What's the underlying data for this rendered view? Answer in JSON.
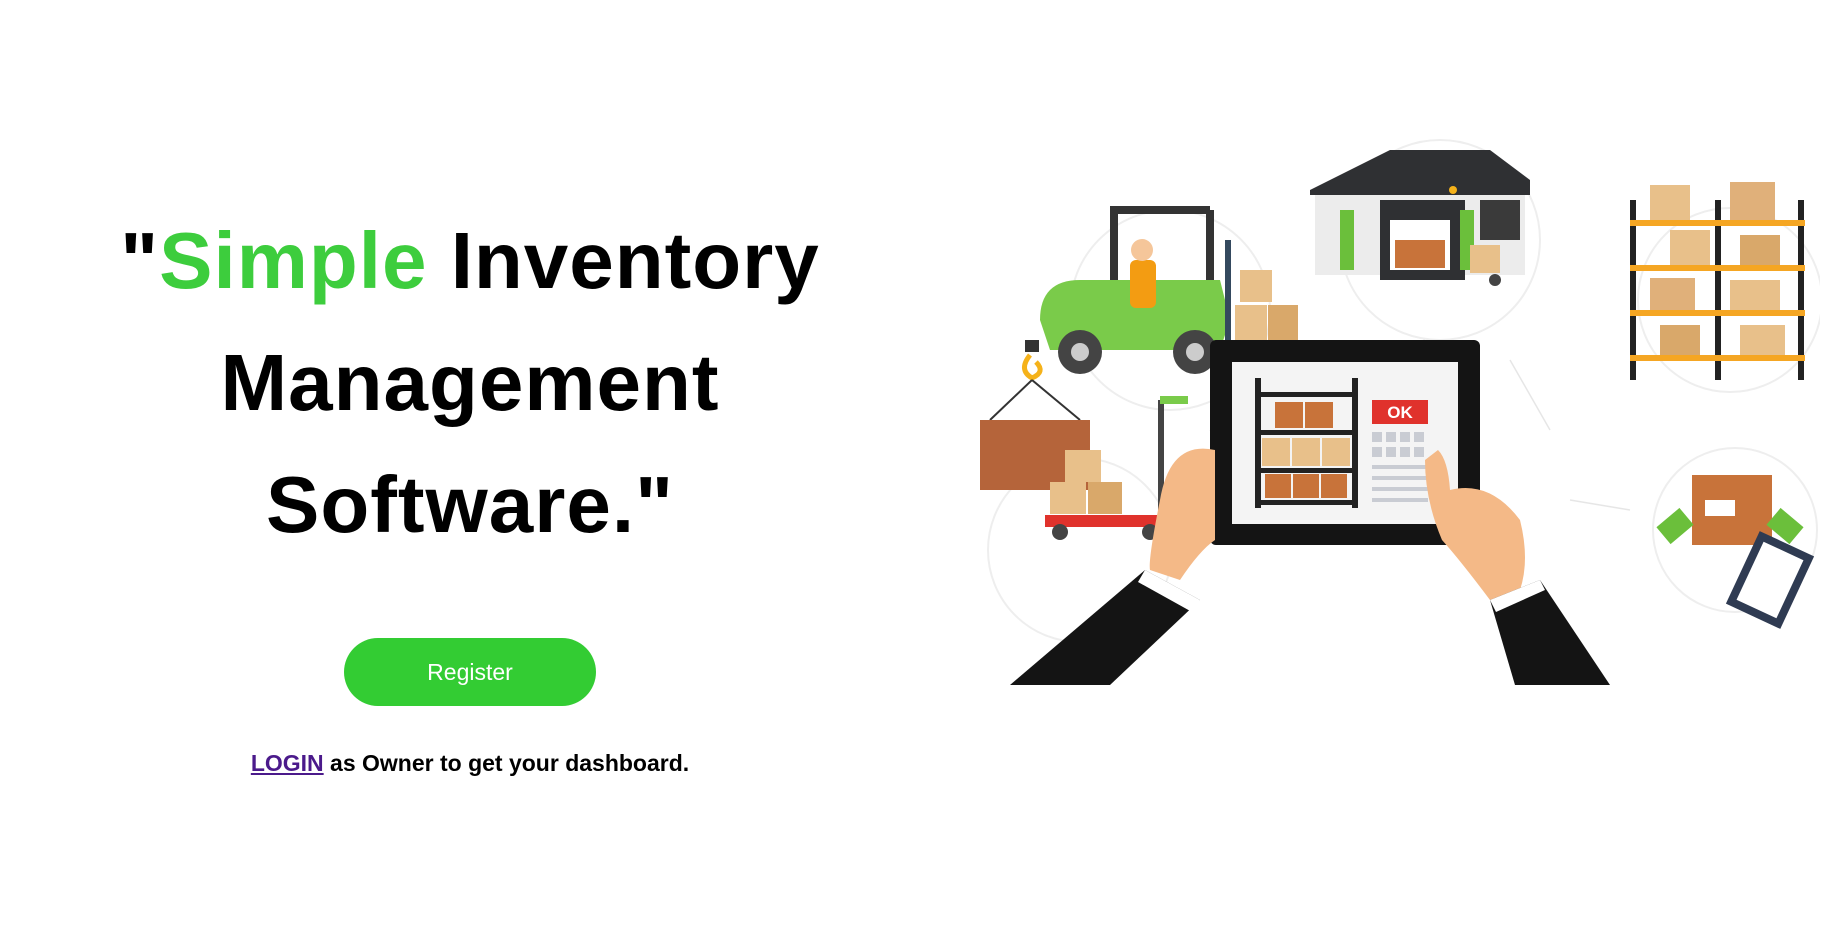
{
  "hero": {
    "headline": {
      "open_quote": "\"",
      "accent_word": "Simple",
      "rest": " Inventory Management Software.\""
    },
    "register_label": "Register",
    "login_link": "LOGIN",
    "login_suffix": " as Owner to get your dashboard."
  },
  "illustration": {
    "ok_label": "OK"
  },
  "colors": {
    "accent": "#3dcd3d",
    "button": "#33cc33",
    "link": "#4b1a8b",
    "text": "#000000"
  }
}
